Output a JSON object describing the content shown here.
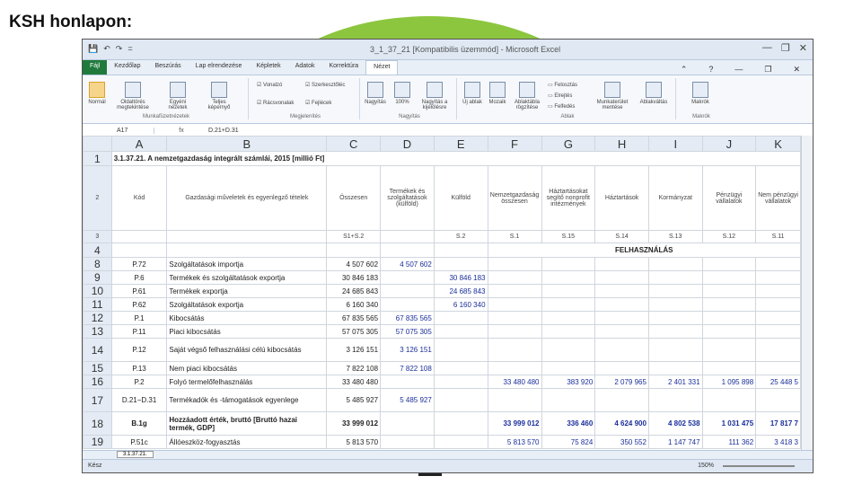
{
  "slide": {
    "title": "KSH honlapon:"
  },
  "window": {
    "title": "3_1_37_21 [Kompatibilis üzemmód] - Microsoft Excel",
    "quick_access": [
      "💾",
      "↶",
      "↷",
      "="
    ],
    "controls": [
      "—",
      "❐",
      "✕"
    ]
  },
  "ribbon": {
    "tabs": [
      "Fájl",
      "Kezdőlap",
      "Beszúrás",
      "Lap elrendezése",
      "Képletek",
      "Adatok",
      "Korrektúra",
      "Nézet"
    ],
    "active_tab": "Nézet",
    "groups": [
      "Munkafüzetnézetek",
      "Megjelenítés",
      "Nagyítás",
      "Ablak",
      "Makrók"
    ],
    "buttons": [
      "Normál",
      "Oldaltörés megtekintése",
      "Egyéni nézetek",
      "Teljes képernyő",
      "Vonalzó",
      "Rácsvonalak",
      "Szerkesztőléc",
      "Fejlécek",
      "Nagyítás",
      "100%",
      "Nagyítás a kijelölésre",
      "Új ablak",
      "Mozaik",
      "Ablaktábla rögzítése",
      "Felosztás",
      "Elrejtés",
      "Felfedés",
      "Munkaterület mentése",
      "Ablakváltás",
      "Makrók"
    ]
  },
  "formula_bar": {
    "name_box": "A17",
    "fx": "fx",
    "content": "D.21+D.31"
  },
  "columns": [
    "A",
    "B",
    "C",
    "D",
    "E",
    "F",
    "G",
    "H",
    "I",
    "J",
    "K"
  ],
  "sheet": {
    "title_row": {
      "num": "1",
      "text": "3.1.37.21. A nemzetgazdaság integrált számlái, 2015 [millió Ft]"
    },
    "header_row": {
      "num": "2",
      "cells": [
        "Kód",
        "Gazdasági műveletek és egyenlegző tételek",
        "Összesen",
        "Termékek és szolgáltatások (külföld)",
        "Külföld",
        "Nemzetgazdaság összesen",
        "Háztartásokat segítő nonprofit intézmények",
        "Háztartások",
        "Kormányzat",
        "Pénzügyi vállalatok",
        "Nem pénzügyi vállalatok"
      ]
    },
    "code_row": {
      "num": "3",
      "cells": [
        "",
        "",
        "S1+S.2",
        "",
        "S.2",
        "S.1",
        "S.15",
        "S.14",
        "S.13",
        "S.12",
        "S.11"
      ]
    },
    "section_row": {
      "num": "4",
      "text": "FELHASZNÁLÁS"
    },
    "rows": [
      {
        "num": "8",
        "code": "P.72",
        "label": "Szolgáltatások importja",
        "c": "4 507 602",
        "d": "4 507 602",
        "e": "",
        "f": "",
        "g": "",
        "h": "",
        "i": "",
        "j": "",
        "k": ""
      },
      {
        "num": "9",
        "code": "P.6",
        "label": "Termékek és szolgáltatások exportja",
        "c": "30 846 183",
        "d": "",
        "e": "30 846 183",
        "f": "",
        "g": "",
        "h": "",
        "i": "",
        "j": "",
        "k": ""
      },
      {
        "num": "10",
        "code": "P.61",
        "label": "Termékek exportja",
        "c": "24 685 843",
        "d": "",
        "e": "24 685 843",
        "f": "",
        "g": "",
        "h": "",
        "i": "",
        "j": "",
        "k": ""
      },
      {
        "num": "11",
        "code": "P.62",
        "label": "Szolgáltatások exportja",
        "c": "6 160 340",
        "d": "",
        "e": "6 160 340",
        "f": "",
        "g": "",
        "h": "",
        "i": "",
        "j": "",
        "k": ""
      },
      {
        "num": "12",
        "code": "P.1",
        "label": "Kibocsátás",
        "c": "67 835 565",
        "d": "67 835 565",
        "e": "",
        "f": "",
        "g": "",
        "h": "",
        "i": "",
        "j": "",
        "k": ""
      },
      {
        "num": "13",
        "code": "P.11",
        "label": "Piaci kibocsátás",
        "c": "57 075 305",
        "d": "57 075 305",
        "e": "",
        "f": "",
        "g": "",
        "h": "",
        "i": "",
        "j": "",
        "k": ""
      },
      {
        "num": "14",
        "code": "P.12",
        "label": "Saját végső felhasználási célú kibocsátás",
        "c": "3 126 151",
        "d": "3 126 151",
        "e": "",
        "f": "",
        "g": "",
        "h": "",
        "i": "",
        "j": "",
        "k": ""
      },
      {
        "num": "15",
        "code": "P.13",
        "label": "Nem piaci kibocsátás",
        "c": "7 822 108",
        "d": "7 822 108",
        "e": "",
        "f": "",
        "g": "",
        "h": "",
        "i": "",
        "j": "",
        "k": ""
      },
      {
        "num": "16",
        "code": "P.2",
        "label": "Folyó termelőfelhasználás",
        "c": "33 480 480",
        "d": "",
        "e": "",
        "f": "33 480 480",
        "g": "383 920",
        "h": "2 079 965",
        "i": "2 401 331",
        "j": "1 095 898",
        "k": "25 448 5"
      },
      {
        "num": "17",
        "code": "D.21−D.31",
        "label": "Termékadók és -támogatások egyenlege",
        "c": "5 485 927",
        "d": "5 485 927",
        "e": "",
        "f": "",
        "g": "",
        "h": "",
        "i": "",
        "j": "",
        "k": ""
      },
      {
        "num": "18",
        "code": "B.1g",
        "label": "Hozzáadott érték, bruttó [Bruttó hazai termék, GDP]",
        "c": "33 999 012",
        "d": "",
        "e": "",
        "f": "33 999 012",
        "g": "336 460",
        "h": "4 624 900",
        "i": "4 802 538",
        "j": "1 031 475",
        "k": "17 817 7",
        "bold": true
      },
      {
        "num": "19",
        "code": "P.51c",
        "label": "Állóeszköz-fogyasztás",
        "c": "5 813 570",
        "d": "",
        "e": "",
        "f": "5 813 570",
        "g": "75 824",
        "h": "350 552",
        "i": "1 147 747",
        "j": "111 362",
        "k": "3 418 3"
      }
    ]
  },
  "sheet_tab": "3.1.37.21.",
  "status": {
    "ready": "Kész",
    "zoom": "150%"
  }
}
